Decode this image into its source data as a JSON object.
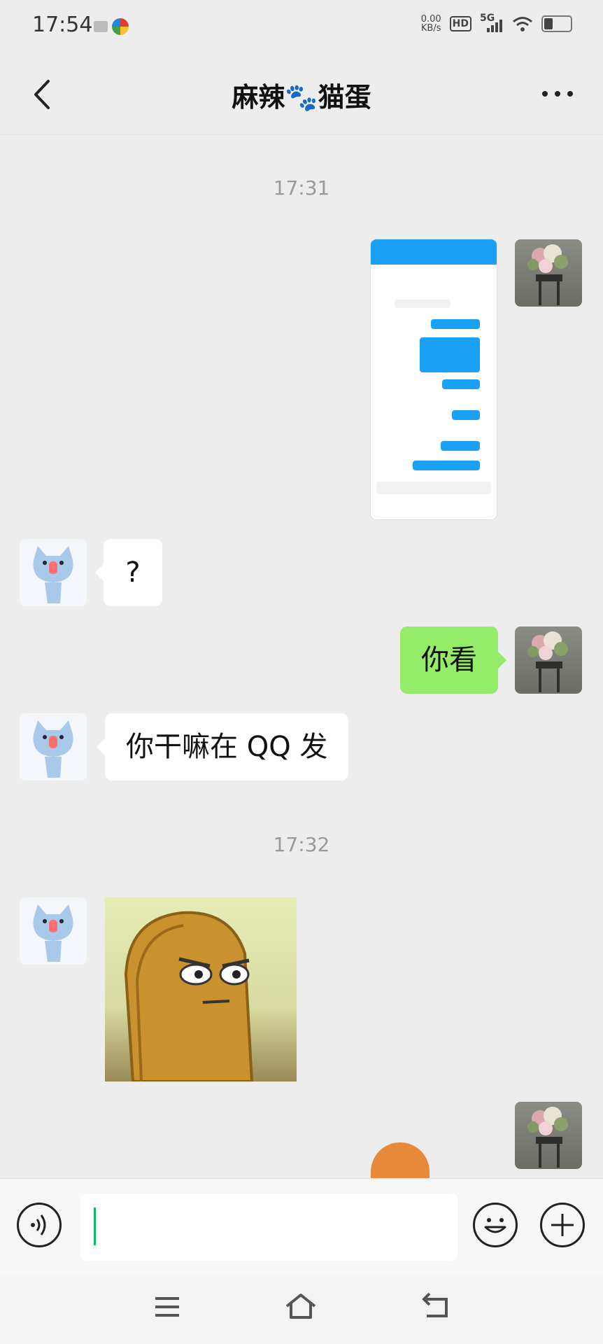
{
  "status_bar": {
    "time": "17:54",
    "net_speed_value": "0.00",
    "net_speed_unit": "KB/s",
    "hd": "HD",
    "signal": "5G"
  },
  "header": {
    "title": "麻辣🐾猫蛋"
  },
  "messages": {
    "time1": "17:31",
    "msg_question": "?",
    "msg_look": "你看",
    "msg_why_qq": "你干嘛在 QQ 发",
    "time2": "17:32"
  },
  "input": {
    "text": ""
  },
  "colors": {
    "background": "#ededed",
    "bubble_self": "#95ec69",
    "bubble_other": "#ffffff",
    "caret": "#07c160"
  }
}
